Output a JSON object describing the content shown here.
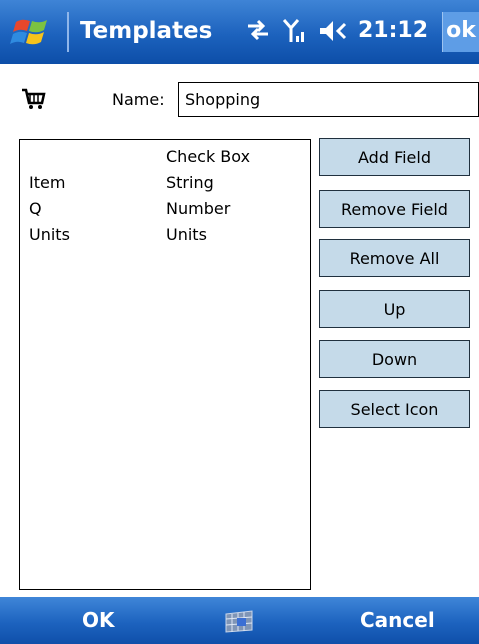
{
  "titlebar": {
    "title": "Templates",
    "time": "21:12",
    "ok_label": "ok",
    "icons": [
      "windows-start-icon",
      "connectivity-icon",
      "signal-icon",
      "volume-icon"
    ]
  },
  "template": {
    "name_label": "Name:",
    "name_value": "Shopping",
    "icon": "shopping-cart-icon"
  },
  "fields": [
    {
      "name": "",
      "type": "Check Box"
    },
    {
      "name": "Item",
      "type": "String"
    },
    {
      "name": "Q",
      "type": "Number"
    },
    {
      "name": "Units",
      "type": "Units"
    }
  ],
  "buttons": {
    "add_field": "Add Field",
    "remove_field": "Remove Field",
    "remove_all": "Remove All",
    "up": "Up",
    "down": "Down",
    "select_icon": "Select Icon"
  },
  "softkeys": {
    "left": "OK",
    "right": "Cancel",
    "center_icon": "keyboard-icon"
  },
  "colors": {
    "titlebar": "#1c62bd",
    "button_face": "#c5dae9",
    "ok_highlight": "#5e9de6"
  }
}
